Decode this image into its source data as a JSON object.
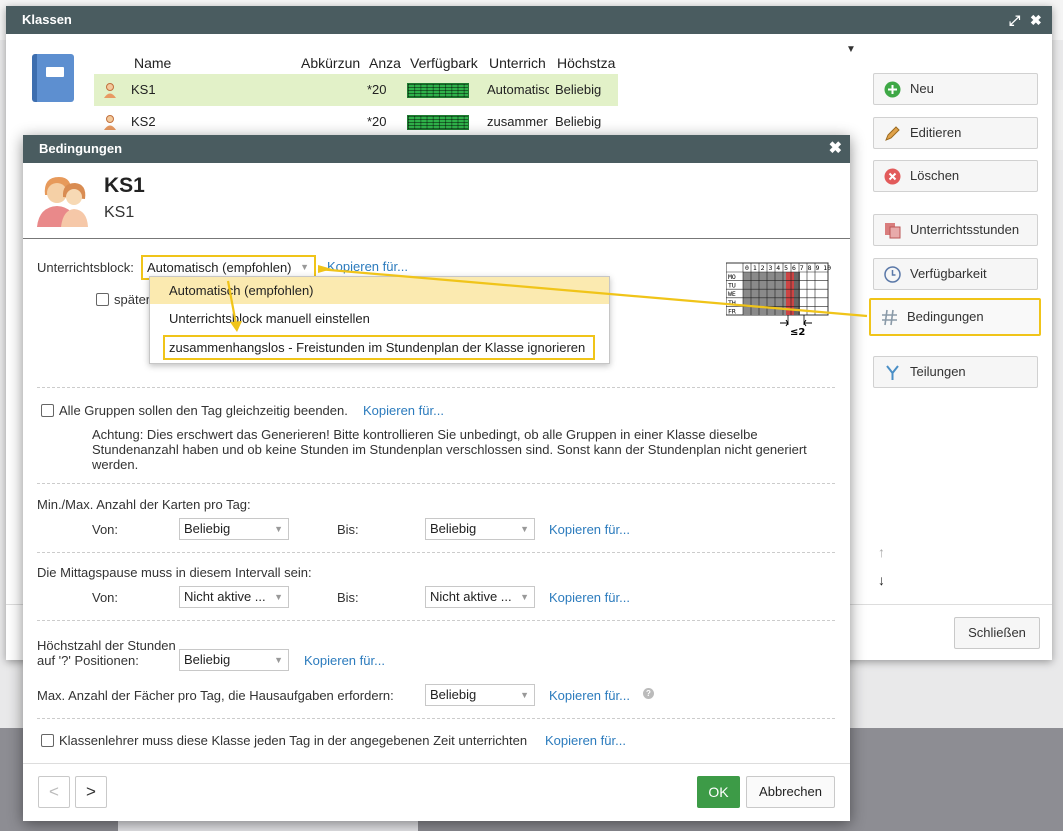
{
  "klassen_window": {
    "title": "Klassen",
    "columns": [
      "Name",
      "Abkürzun",
      "Anza",
      "Verfügbark",
      "Unterrich",
      "Höchstza"
    ],
    "rows": [
      {
        "name": "KS1",
        "count": "*20",
        "unterricht": "Automatisc",
        "hoechst": "Beliebig"
      },
      {
        "name": "KS2",
        "count": "*20",
        "unterricht": "zusammer",
        "hoechst": "Beliebig"
      }
    ],
    "side_buttons": {
      "neu": "Neu",
      "editieren": "Editieren",
      "loeschen": "Löschen",
      "unterrichtsstunden": "Unterrichtsstunden",
      "verfuegbarkeit": "Verfügbarkeit",
      "bedingungen": "Bedingungen",
      "teilungen": "Teilungen"
    },
    "close_label": "Schließen"
  },
  "dialog": {
    "title": "Bedingungen",
    "class_name": "KS1",
    "class_short": "KS1",
    "unterrichtsblock": {
      "label": "Unterrichtsblock:",
      "value": "Automatisch (empfohlen)",
      "copy": "Kopieren für...",
      "options": [
        "Automatisch (empfohlen)",
        "Unterrichtsblock manuell einstellen",
        "zusammenhangslos - Freistunden im Stundenplan der Klasse ignorieren"
      ],
      "later_checkbox": "später"
    },
    "alle_gruppen": {
      "label": "Alle Gruppen sollen den Tag gleichzeitig beenden.",
      "copy": "Kopieren für...",
      "note": "Achtung: Dies erschwert das Generieren! Bitte kontrollieren Sie unbedingt, ob alle Gruppen in einer Klasse dieselbe Stundenanzahl haben und ob keine Stunden im Stundenplan verschlossen sind. Sonst kann der Stundenplan nicht generiert werden."
    },
    "karten": {
      "label": "Min./Max. Anzahl der Karten pro Tag:",
      "von_label": "Von:",
      "von_value": "Beliebig",
      "bis_label": "Bis:",
      "bis_value": "Beliebig",
      "copy": "Kopieren für..."
    },
    "mittag": {
      "label": "Die Mittagspause muss in diesem Intervall sein:",
      "von_label": "Von:",
      "von_value": "Nicht aktive ...",
      "bis_label": "Bis:",
      "bis_value": "Nicht aktive ...",
      "copy": "Kopieren für..."
    },
    "hoechstzahl": {
      "label_line1": "Höchstzahl der Stunden",
      "label_line2": "auf '?' Positionen:",
      "value": "Beliebig",
      "copy": "Kopieren für..."
    },
    "hausaufgaben": {
      "label": "Max. Anzahl der Fächer pro Tag, die  Hausaufgaben erfordern:",
      "value": "Beliebig",
      "copy": "Kopieren für..."
    },
    "klassenlehrer": {
      "label": "Klassenlehrer muss diese Klasse jeden Tag in der angegebenen Zeit unterrichten",
      "copy": "Kopieren für..."
    },
    "thumb": {
      "hours": "0 1 2 3 4 5 6 7 8 9 10",
      "days": [
        "MO",
        "TU",
        "WE",
        "TH",
        "FR"
      ],
      "caption": "≤2"
    },
    "buttons": {
      "prev": "<",
      "next": ">",
      "ok": "OK",
      "cancel": "Abbrechen"
    }
  },
  "colors": {
    "titlebar": "#4a5c60",
    "highlight": "#f0c419",
    "link": "#2b7bbd",
    "ok_green": "#3d9b47",
    "selected_row": "#e2f1c8"
  }
}
